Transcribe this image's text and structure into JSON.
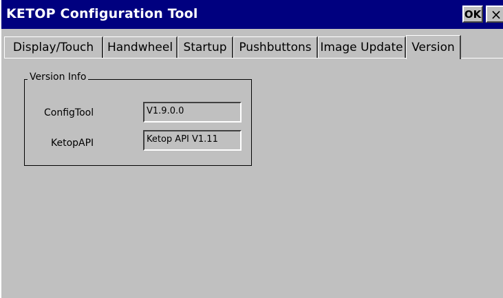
{
  "window": {
    "title": "KETOP Configuration Tool",
    "ok_label": "OK",
    "close_label": "×"
  },
  "tabs": [
    {
      "label": "Display/Touch",
      "active": false
    },
    {
      "label": "Handwheel",
      "active": false
    },
    {
      "label": "Startup",
      "active": false
    },
    {
      "label": "Pushbuttons",
      "active": false
    },
    {
      "label": "Image Update",
      "active": false
    },
    {
      "label": "Version",
      "active": true
    }
  ],
  "version_info": {
    "legend": "Version Info",
    "rows": [
      {
        "label": "ConfigTool",
        "value": "V1.9.0.0"
      },
      {
        "label": "KetopAPI",
        "value": "Ketop API V1.11"
      }
    ]
  },
  "colors": {
    "titlebar": "#00007f",
    "face": "#c0c0c0"
  },
  "icons": {
    "close": "close-icon"
  }
}
